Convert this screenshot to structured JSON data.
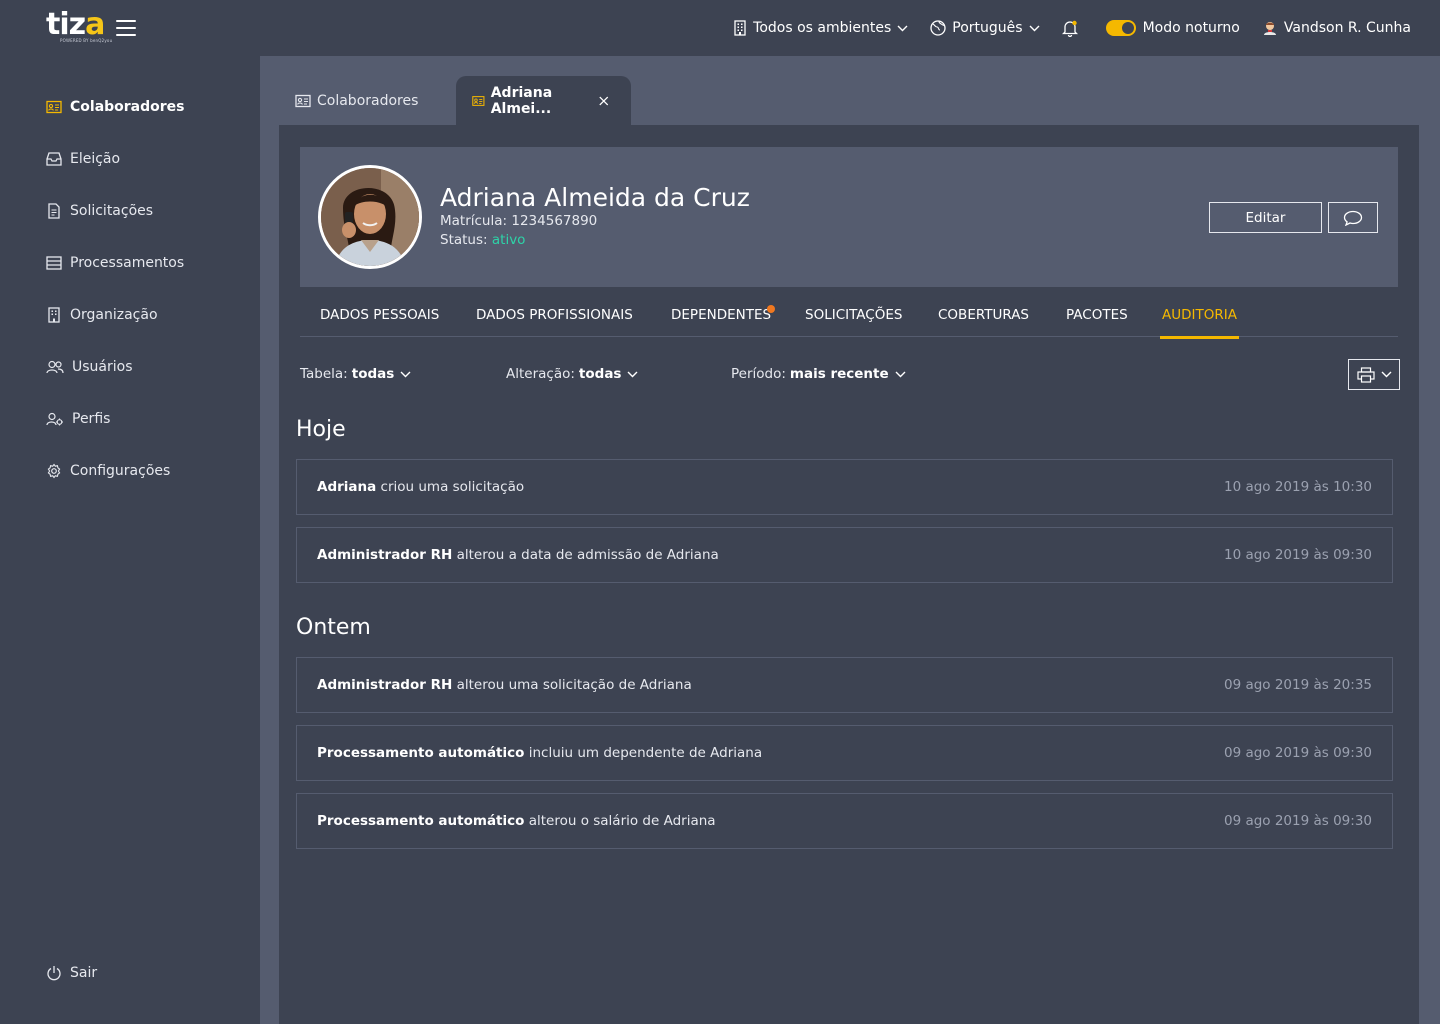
{
  "header": {
    "logo_text_main": "tiz",
    "logo_text_accent": "a",
    "logo_sub": "POWERED BY benQ2you",
    "environment_label": "Todos os ambientes",
    "language_label": "Português",
    "dark_mode_label": "Modo noturno",
    "user_name": "Vandson R. Cunha",
    "accent_color": "#f5b800"
  },
  "sidebar": {
    "items": [
      {
        "label": "Colaboradores",
        "icon": "id-card-icon"
      },
      {
        "label": "Eleição",
        "icon": "inbox-icon"
      },
      {
        "label": "Solicitações",
        "icon": "document-icon"
      },
      {
        "label": "Processamentos",
        "icon": "list-icon"
      },
      {
        "label": "Organização",
        "icon": "building-icon"
      },
      {
        "label": "Usuários",
        "icon": "users-icon"
      },
      {
        "label": "Perfis",
        "icon": "user-gear-icon"
      },
      {
        "label": "Configurações",
        "icon": "gear-icon"
      }
    ],
    "logout_label": "Sair"
  },
  "tabs": {
    "first_label": "Colaboradores",
    "active_label": "Adriana Almei..."
  },
  "profile": {
    "name": "Adriana Almeida da Cruz",
    "registration_label": "Matrícula:",
    "registration_value": "1234567890",
    "status_label": "Status:",
    "status_value": "ativo",
    "edit_label": "Editar"
  },
  "section_tabs": [
    "DADOS PESSOAIS",
    "DADOS PROFISSIONAIS",
    "DEPENDENTES",
    "SOLICITAÇÕES",
    "COBERTURAS",
    "PACOTES",
    "AUDITORIA"
  ],
  "active_section": "AUDITORIA",
  "filters": {
    "table_label": "Tabela:",
    "table_value": "todas",
    "change_label": "Alteração:",
    "change_value": "todas",
    "period_label": "Período:",
    "period_value": "mais recente"
  },
  "groups": [
    {
      "title": "Hoje",
      "entries": [
        {
          "actor": "Adriana",
          "action": "criou uma solicitação",
          "time": "10 ago 2019 às 10:30"
        },
        {
          "actor": "Administrador RH",
          "action": "alterou a data de admissão de Adriana",
          "time": "10 ago 2019 às 09:30"
        }
      ]
    },
    {
      "title": "Ontem",
      "entries": [
        {
          "actor": "Administrador RH",
          "action": "alterou uma solicitação de Adriana",
          "time": "09 ago 2019 às 20:35"
        },
        {
          "actor": "Processamento automático",
          "action": "incluiu um dependente de Adriana",
          "time": "09 ago 2019 às 09:30"
        },
        {
          "actor": "Processamento automático",
          "action": "alterou o salário de Adriana",
          "time": "09 ago 2019 às 09:30"
        }
      ]
    }
  ]
}
